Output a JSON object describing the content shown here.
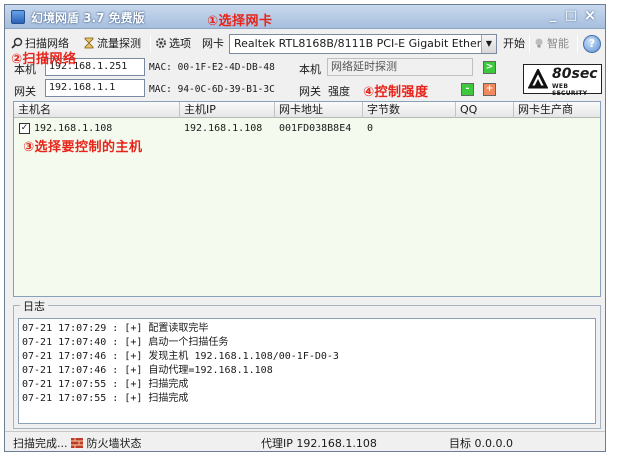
{
  "window": {
    "title": "幻境网盾 3.7 免费版",
    "min": "_",
    "max": "□",
    "close": "×"
  },
  "toolbar": {
    "scan_label": "扫描网络",
    "traffic_label": "流量探测",
    "options_label": "选项",
    "nic_label": "网卡",
    "nic_value": "Realtek RTL8168B/8111B PCI-E Gigabit Ethern",
    "start_label": "开始",
    "smart_label": "智能",
    "help": "?"
  },
  "local": {
    "label": "本机",
    "ip": "192.168.1.251",
    "mac": "MAC: 00-1F-E2-4D-DB-48",
    "label2": "本机",
    "status": "网络延时探测",
    "go": ">"
  },
  "gateway": {
    "label": "网关",
    "ip": "192.168.1.1",
    "mac": "MAC: 94-0C-6D-39-B1-3C",
    "label2": "网关",
    "strength_label": "强度",
    "minus": "-",
    "plus": "+"
  },
  "logo": {
    "main": "80sec",
    "sub": "WEB SECURITY"
  },
  "hosts": {
    "columns": [
      "主机名",
      "主机IP",
      "网卡地址",
      "字节数",
      "QQ",
      "网卡生产商"
    ],
    "rows": [
      {
        "checked": "✓",
        "name": "192.168.1.108",
        "ip": "192.168.1.108",
        "mac": "001FD038B8E4",
        "bytes": "0",
        "qq": "",
        "vendor": ""
      }
    ]
  },
  "log": {
    "title": "日志",
    "lines": [
      "07-21 17:07:29 : [+] 配置读取完毕",
      "07-21 17:07:40 : [+] 启动一个扫描任务",
      "07-21 17:07:46 : [+] 发现主机 192.168.1.108/00-1F-D0-3",
      "07-21 17:07:46 : [+] 自动代理=192.168.1.108",
      "07-21 17:07:55 : [+] 扫描完成",
      "07-21 17:07:55 : [+] 扫描完成"
    ]
  },
  "status": {
    "scan": "扫描完成...",
    "firewall": "防火墙状态",
    "proxy": "代理IP 192.168.1.108",
    "target": "目标 0.0.0.0"
  },
  "annotations": {
    "a1": "①选择网卡",
    "a2": "②扫描网络",
    "a3": "③选择要控制的主机",
    "a4": "④控制强度"
  },
  "colors": {
    "accent_red": "#e8231a",
    "go_green": "#3dc83d",
    "plus_orange": "#f08a5d",
    "list_bg": "#f4fbee"
  }
}
